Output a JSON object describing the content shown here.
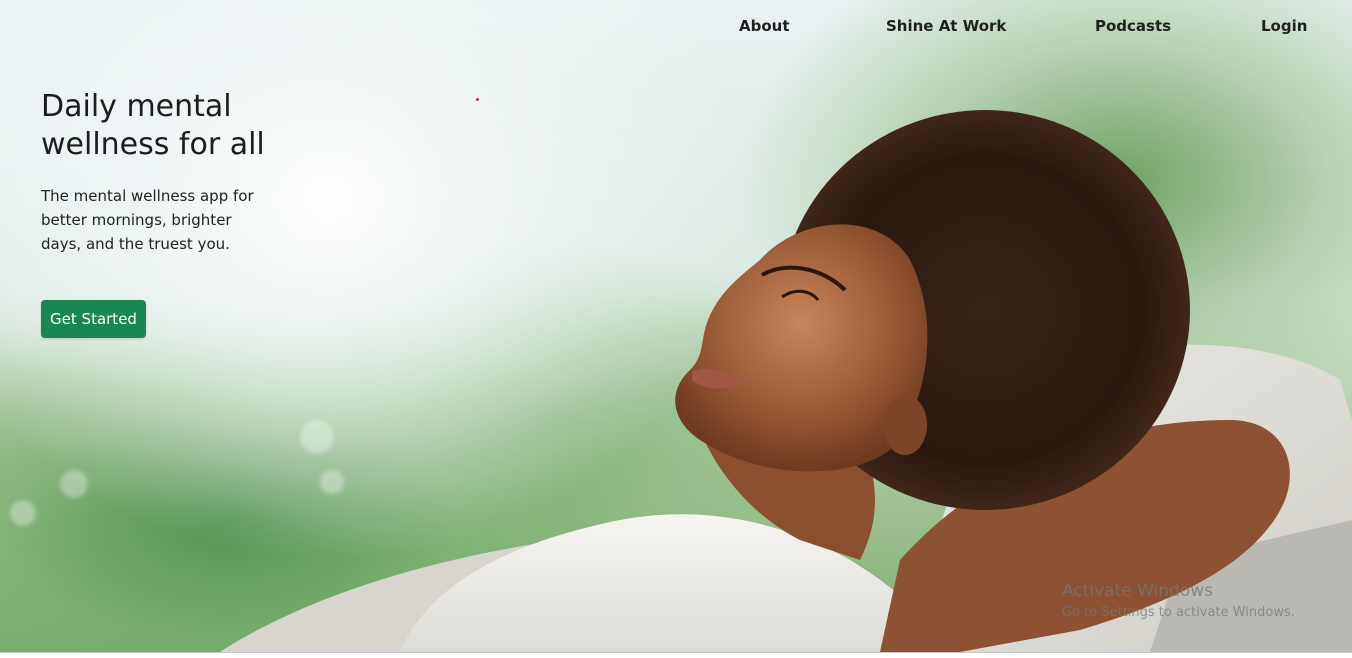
{
  "nav": {
    "items": [
      {
        "label": "About"
      },
      {
        "label": "Shine At Work"
      },
      {
        "label": "Podcasts"
      },
      {
        "label": "Login"
      }
    ]
  },
  "hero": {
    "title": "Daily mental wellness for all",
    "subtitle": "The mental wellness app for better mornings, brighter days, and the truest you.",
    "cta_label": "Get Started",
    "image": "woman-relaxing-smiling-image"
  },
  "watermark": {
    "title": "Activate Windows",
    "subtitle": "Go to Settings to activate Windows."
  },
  "colors": {
    "accent": "#198754",
    "text": "#1d1d1d",
    "nav_text": "#1f1f1f"
  }
}
